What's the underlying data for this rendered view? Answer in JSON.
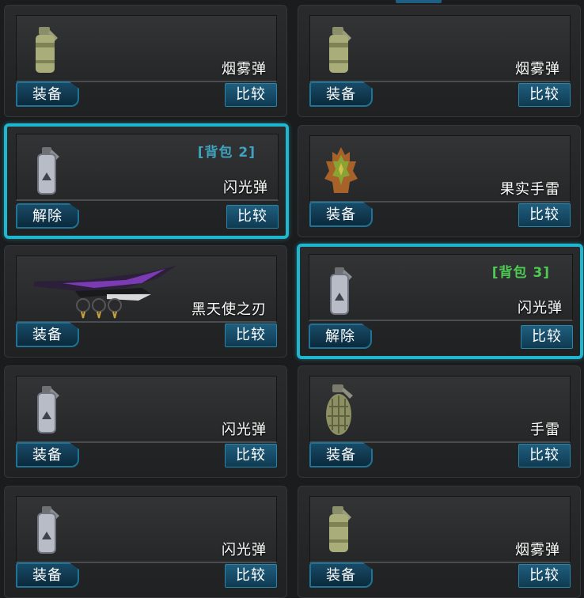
{
  "cards": [
    {
      "name": "烟雾弹",
      "tag": "",
      "action": "装备",
      "compare": "比较",
      "icon": "smoke-grenade-icon"
    },
    {
      "name": "烟雾弹",
      "tag": "",
      "action": "装备",
      "compare": "比较",
      "icon": "smoke-grenade-icon"
    },
    {
      "name": "闪光弹",
      "tag": "[背包 2]",
      "action": "解除",
      "compare": "比较",
      "icon": "flash-grenade-icon",
      "selected": true
    },
    {
      "name": "果实手雷",
      "tag": "",
      "action": "装备",
      "compare": "比较",
      "icon": "fruit-grenade-icon"
    },
    {
      "name": "黑天使之刃",
      "tag": "",
      "action": "装备",
      "compare": "比较",
      "icon": "dark-angel-blade-icon"
    },
    {
      "name": "闪光弹",
      "tag": "[背包 3]",
      "action": "解除",
      "compare": "比较",
      "icon": "flash-grenade-icon",
      "selected": true
    },
    {
      "name": "闪光弹",
      "tag": "",
      "action": "装备",
      "compare": "比较",
      "icon": "flash-grenade-icon"
    },
    {
      "name": "手雷",
      "tag": "",
      "action": "装备",
      "compare": "比较",
      "icon": "hand-grenade-icon"
    },
    {
      "name": "闪光弹",
      "tag": "",
      "action": "装备",
      "compare": "比较",
      "icon": "flash-grenade-icon"
    },
    {
      "name": "烟雾弹",
      "tag": "",
      "action": "装备",
      "compare": "比较",
      "icon": "smoke-grenade-icon"
    }
  ],
  "colors": {
    "selected_border": "#1fb7cf",
    "button_fill": "#184a66",
    "tag_blue": "#3fa3c0",
    "tag_green": "#4ecb52"
  }
}
